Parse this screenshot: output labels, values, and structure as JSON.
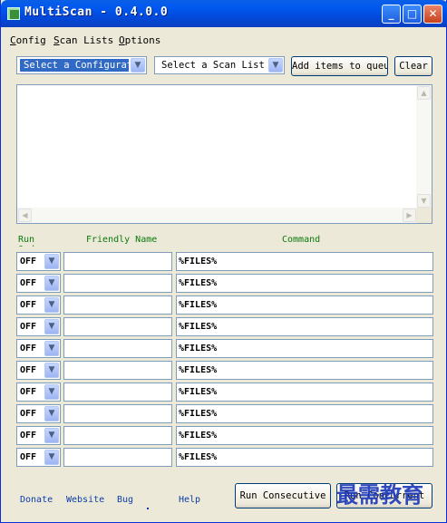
{
  "window": {
    "title": "MultiScan - 0.4.0.0"
  },
  "titlebar": {
    "minimize": "_",
    "maximize": "□",
    "close": "✕"
  },
  "menu": [
    {
      "label_u": "C",
      "label_rest": "onfig"
    },
    {
      "label_u": "S",
      "label_rest": "can Lists"
    },
    {
      "label_u": "O",
      "label_rest": "ptions"
    }
  ],
  "toolbar": {
    "config_select": "Select a Configurat",
    "scanlist_select": "Select a Scan List",
    "add_button": "Add items to queue",
    "clear_button": "Clear"
  },
  "columns": {
    "run": "Run Order",
    "friendly": "Friendly Name",
    "command": "Command"
  },
  "rows": [
    {
      "run": "OFF",
      "name": "",
      "command": "%FILES%"
    },
    {
      "run": "OFF",
      "name": "",
      "command": "%FILES%"
    },
    {
      "run": "OFF",
      "name": "",
      "command": "%FILES%"
    },
    {
      "run": "OFF",
      "name": "",
      "command": "%FILES%"
    },
    {
      "run": "OFF",
      "name": "",
      "command": "%FILES%"
    },
    {
      "run": "OFF",
      "name": "",
      "command": "%FILES%"
    },
    {
      "run": "OFF",
      "name": "",
      "command": "%FILES%"
    },
    {
      "run": "OFF",
      "name": "",
      "command": "%FILES%"
    },
    {
      "run": "OFF",
      "name": "",
      "command": "%FILES%"
    },
    {
      "run": "OFF",
      "name": "",
      "command": "%FILES%"
    }
  ],
  "footer": {
    "donate": "Donate",
    "website": "Website",
    "bug": "Bug",
    "help": "Help",
    "run_consecutive": "Run Consecutive",
    "run_concurrent": "Run Concurrent"
  },
  "watermark": "最需教育"
}
